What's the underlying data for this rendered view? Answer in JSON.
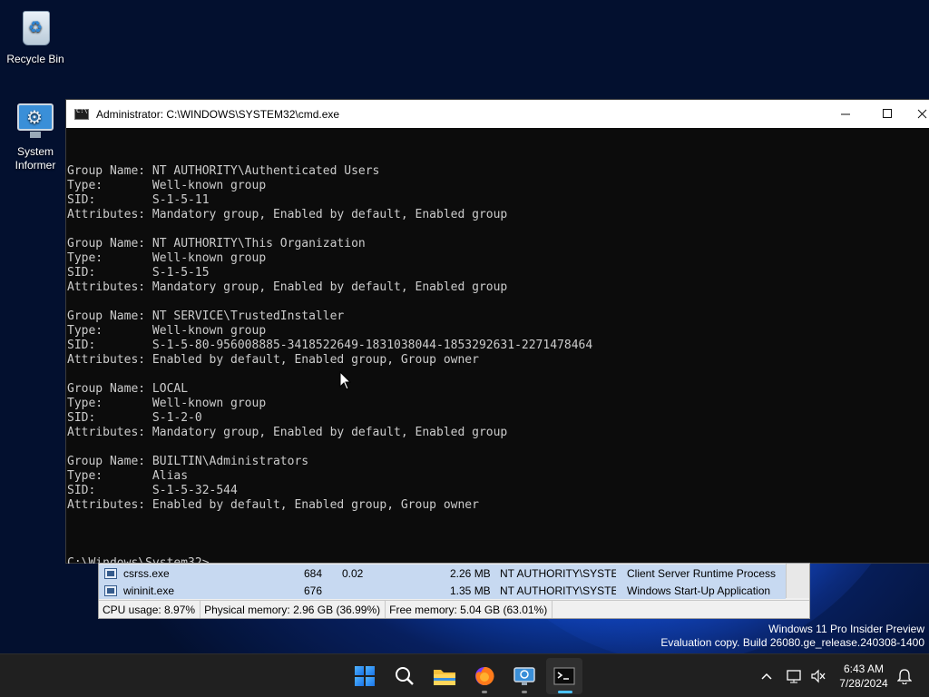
{
  "desktop": {
    "icons": [
      {
        "label": "Recycle Bin",
        "icon": "recycle-bin-icon"
      },
      {
        "label": "System\nInformer",
        "icon": "system-informer-icon"
      }
    ]
  },
  "cmd": {
    "title": "Administrator: C:\\WINDOWS\\SYSTEM32\\cmd.exe",
    "lines": [
      "Group Name: NT AUTHORITY\\Authenticated Users",
      "Type:       Well-known group",
      "SID:        S-1-5-11",
      "Attributes: Mandatory group, Enabled by default, Enabled group",
      "",
      "Group Name: NT AUTHORITY\\This Organization",
      "Type:       Well-known group",
      "SID:        S-1-5-15",
      "Attributes: Mandatory group, Enabled by default, Enabled group",
      "",
      "Group Name: NT SERVICE\\TrustedInstaller",
      "Type:       Well-known group",
      "SID:        S-1-5-80-956008885-3418522649-1831038044-1853292631-2271478464",
      "Attributes: Enabled by default, Enabled group, Group owner",
      "",
      "Group Name: LOCAL",
      "Type:       Well-known group",
      "SID:        S-1-2-0",
      "Attributes: Mandatory group, Enabled by default, Enabled group",
      "",
      "Group Name: BUILTIN\\Administrators",
      "Type:       Alias",
      "SID:        S-1-5-32-544",
      "Attributes: Enabled by default, Enabled group, Group owner",
      ""
    ],
    "prompt": "C:\\Windows\\System32>"
  },
  "system_informer": {
    "processes": [
      {
        "name": "csrss.exe",
        "pid": "684",
        "cpu": "0.02",
        "memory": "2.26 MB",
        "user": "NT AUTHORITY\\SYSTEM",
        "description": "Client Server Runtime Process"
      },
      {
        "name": "wininit.exe",
        "pid": "676",
        "cpu": "",
        "memory": "1.35 MB",
        "user": "NT AUTHORITY\\SYSTEM",
        "description": "Windows Start-Up Application"
      }
    ],
    "status": {
      "cpu": "CPU usage: 8.97%",
      "physical": "Physical memory: 2.96 GB (36.99%)",
      "free": "Free memory: 5.04 GB (63.01%)"
    }
  },
  "watermark": {
    "line1": "Windows 11 Pro Insider Preview",
    "line2": "Evaluation copy. Build 26080.ge_release.240308-1400"
  },
  "taskbar": {
    "apps": [
      "start-icon",
      "search-icon",
      "file-explorer-icon",
      "firefox-icon",
      "system-informer-icon",
      "terminal-icon"
    ],
    "time": "6:43 AM",
    "date": "7/28/2024"
  }
}
